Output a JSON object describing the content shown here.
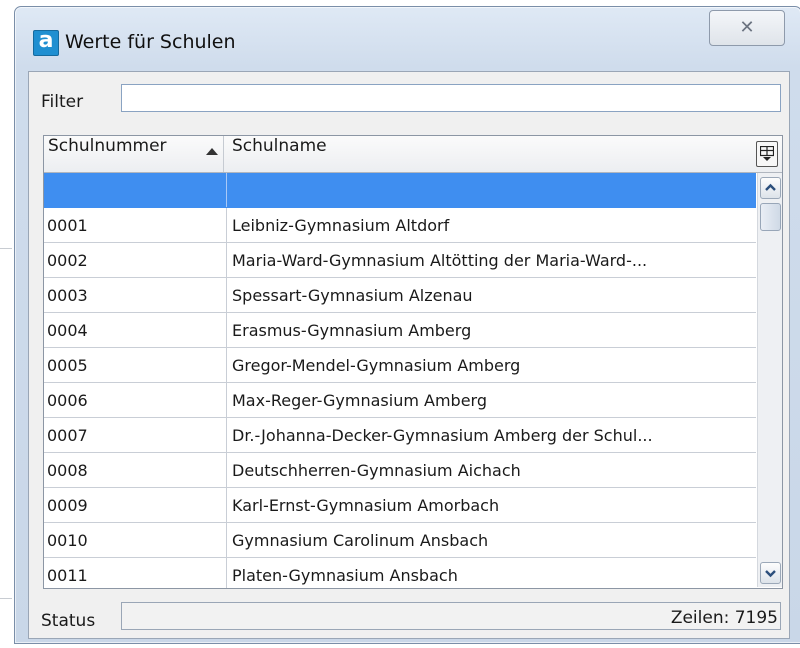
{
  "window": {
    "title": "Werte für Schulen",
    "app_icon_letter": "a",
    "close_glyph": "✕"
  },
  "filter": {
    "label": "Filter",
    "value": "",
    "placeholder": ""
  },
  "table": {
    "columns": [
      "Schulnummer",
      "Schulname"
    ],
    "sort_column": "Schulnummer",
    "sort_direction": "ascending",
    "rows": [
      {
        "num": "",
        "name": ""
      },
      {
        "num": "0001",
        "name": "Leibniz-Gymnasium Altdorf"
      },
      {
        "num": "0002",
        "name": "Maria-Ward-Gymnasium Altötting der Maria-Ward-..."
      },
      {
        "num": "0003",
        "name": "Spessart-Gymnasium Alzenau"
      },
      {
        "num": "0004",
        "name": "Erasmus-Gymnasium Amberg"
      },
      {
        "num": "0005",
        "name": "Gregor-Mendel-Gymnasium Amberg"
      },
      {
        "num": "0006",
        "name": "Max-Reger-Gymnasium Amberg"
      },
      {
        "num": "0007",
        "name": "Dr.-Johanna-Decker-Gymnasium Amberg der Schul..."
      },
      {
        "num": "0008",
        "name": "Deutschherren-Gymnasium Aichach"
      },
      {
        "num": "0009",
        "name": "Karl-Ernst-Gymnasium Amorbach"
      },
      {
        "num": "0010",
        "name": "Gymnasium Carolinum Ansbach"
      },
      {
        "num": "0011",
        "name": "Platen-Gymnasium Ansbach"
      }
    ],
    "selected_row_index": 0
  },
  "status": {
    "label": "Status",
    "count_text": "Zeilen: 7195"
  },
  "colors": {
    "selection": "#3f8ef0",
    "app_icon": "#1f8fd1"
  },
  "icons": [
    "app-icon",
    "close-icon",
    "sort-ascending-icon",
    "column-chooser-icon",
    "scroll-up-icon",
    "scroll-down-icon"
  ]
}
